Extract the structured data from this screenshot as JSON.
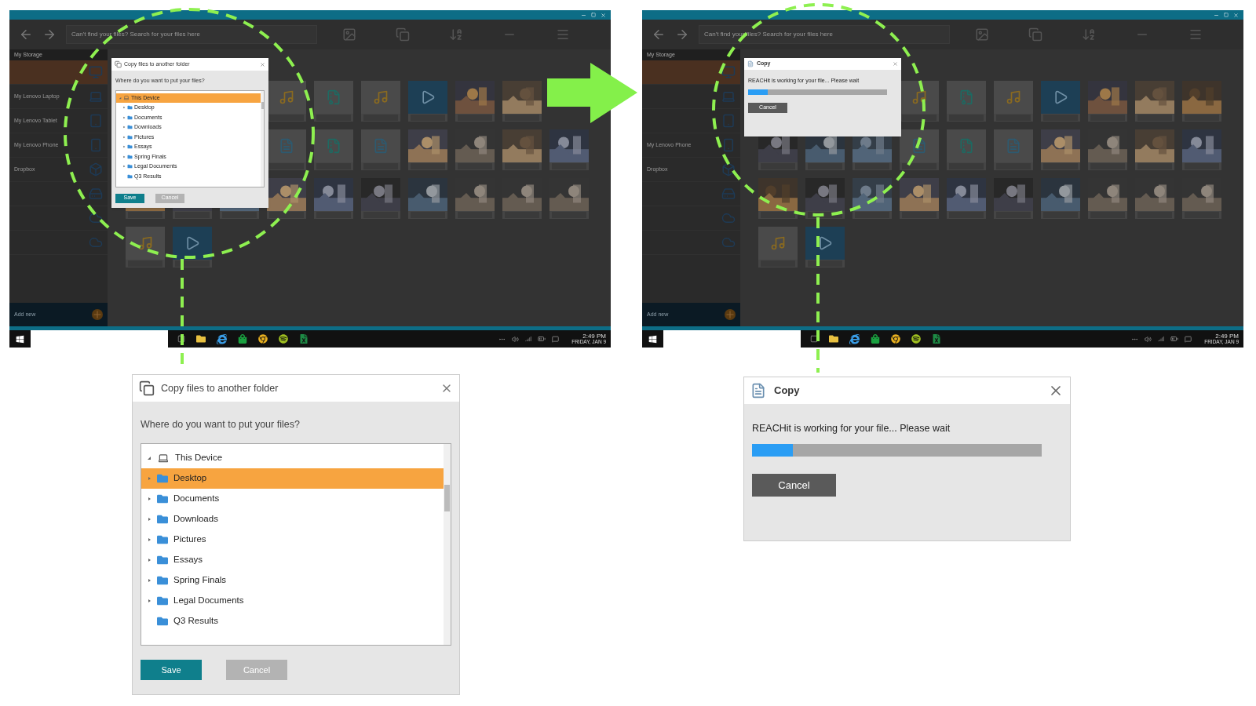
{
  "screens": [
    {
      "kind": "folder-picker",
      "app": {
        "search_placeholder": "Can't find your files? Search for your files here",
        "storage_title": "My Storage",
        "devices": [
          {
            "kind": "desktop",
            "selected": true
          },
          {
            "kind": "laptop",
            "label": "My Lenovo Laptop",
            "selected": false
          },
          {
            "kind": "tablet",
            "label": "My Lenovo Tablet",
            "selected": false
          },
          {
            "kind": "phone",
            "label": "My Lenovo Phone",
            "selected": false
          },
          {
            "kind": "dropbox",
            "label": "Dropbox",
            "selected": false
          },
          {
            "kind": "drive",
            "selected": false
          },
          {
            "kind": "cloud",
            "selected": false
          },
          {
            "kind": "cloud",
            "selected": false
          }
        ],
        "add_new": "Add new",
        "clock": {
          "time": "2:49 PM",
          "date": "FRIDAY, JAN 9"
        }
      },
      "dialog": {
        "title": "Copy files to another folder",
        "question": "Where do you want to put your files?",
        "tree": {
          "label": "This Device",
          "selected": true,
          "expanded": true,
          "children": [
            {
              "label": "Desktop",
              "selected": false,
              "expandable": true
            },
            {
              "label": "Documents",
              "selected": false,
              "expandable": true
            },
            {
              "label": "Downloads",
              "selected": false,
              "expandable": true
            },
            {
              "label": "Pictures",
              "selected": false,
              "expandable": true
            },
            {
              "label": "Essays",
              "selected": false,
              "expandable": true
            },
            {
              "label": "Spring Finals",
              "selected": false,
              "expandable": true
            },
            {
              "label": "Legal Documents",
              "selected": false,
              "expandable": true
            },
            {
              "label": "Q3 Results",
              "selected": false,
              "expandable": false
            }
          ]
        },
        "buttons": [
          {
            "label": "Save",
            "kind": "primary"
          },
          {
            "label": "Cancel",
            "kind": "secondary"
          }
        ]
      }
    },
    {
      "kind": "progress",
      "app": {
        "search_placeholder": "Can't find your files? Search for your files here",
        "storage_title": "My Storage",
        "devices": [
          {
            "kind": "desktop",
            "selected": true
          },
          {
            "kind": "laptop",
            "selected": false
          },
          {
            "kind": "tablet",
            "selected": false
          },
          {
            "kind": "phone",
            "label": "My Lenovo Phone",
            "selected": false
          },
          {
            "kind": "dropbox",
            "label": "Dropbox",
            "selected": false
          },
          {
            "kind": "drive",
            "selected": false
          },
          {
            "kind": "cloud",
            "selected": false
          },
          {
            "kind": "cloud",
            "selected": false
          }
        ],
        "add_new": "Add new",
        "clock": {
          "time": "2:49 PM",
          "date": "FRIDAY, JAN 9"
        }
      },
      "dialog": {
        "title": "Copy",
        "message": "REACHit is working for your file... Please wait",
        "progress": {
          "level": 0.14
        },
        "buttons": [
          {
            "label": "Cancel",
            "kind": "dark"
          }
        ]
      }
    }
  ],
  "zoomed": [
    {
      "kind": "folder-picker",
      "dialog": {
        "title": "Copy files to another folder",
        "question": "Where do you want to put your files?",
        "tree": {
          "label": "This Device",
          "selected": false,
          "expanded": true,
          "children": [
            {
              "label": "Desktop",
              "selected": true,
              "expandable": true
            },
            {
              "label": "Documents",
              "selected": false,
              "expandable": true
            },
            {
              "label": "Downloads",
              "selected": false,
              "expandable": true
            },
            {
              "label": "Pictures",
              "selected": false,
              "expandable": true
            },
            {
              "label": "Essays",
              "selected": false,
              "expandable": true
            },
            {
              "label": "Spring Finals",
              "selected": false,
              "expandable": true
            },
            {
              "label": "Legal Documents",
              "selected": false,
              "expandable": true
            },
            {
              "label": "Q3 Results",
              "selected": false,
              "expandable": false
            }
          ]
        },
        "buttons": [
          {
            "label": "Save",
            "kind": "primary"
          },
          {
            "label": "Cancel",
            "kind": "secondary"
          }
        ]
      }
    },
    {
      "kind": "progress",
      "dialog": {
        "title": "Copy",
        "message": "REACHit is working for your file... Please wait",
        "progress": {
          "level": 0.14
        },
        "buttons": [
          {
            "label": "Cancel",
            "kind": "dark"
          }
        ]
      }
    }
  ]
}
